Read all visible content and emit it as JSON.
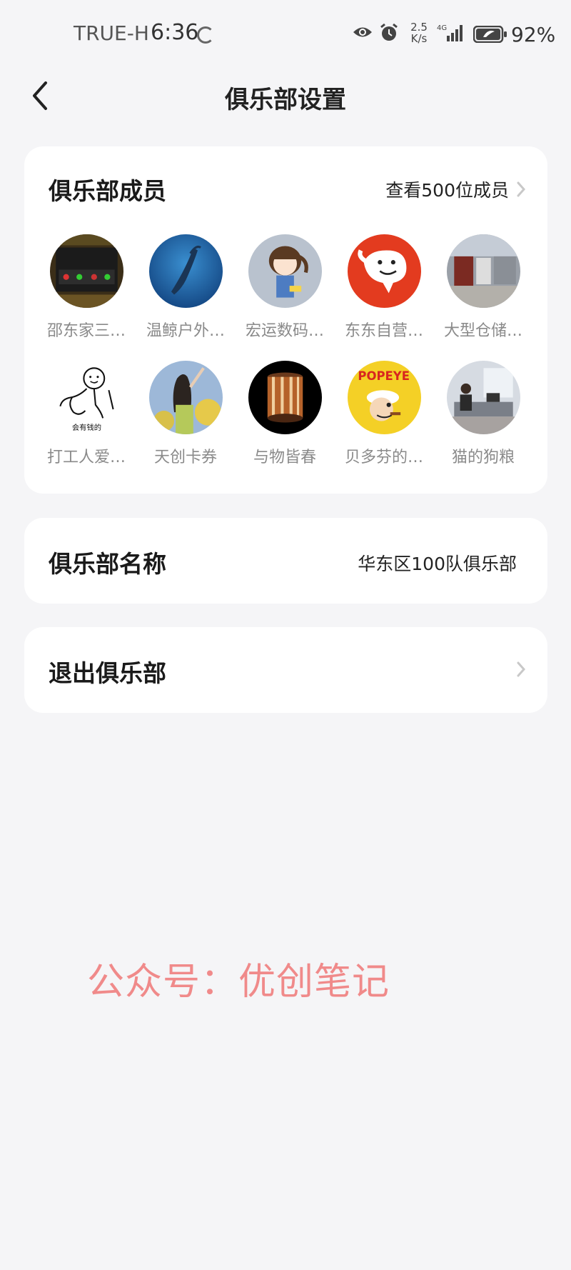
{
  "status_bar": {
    "carrier": "TRUE-H",
    "time": "6:36",
    "net_speed_value": "2.5",
    "net_speed_unit": "K/s",
    "network_type": "4G",
    "battery": "92%"
  },
  "header": {
    "title": "俱乐部设置"
  },
  "members": {
    "title": "俱乐部成员",
    "view_all": "查看500位成员",
    "items": [
      {
        "name": "邵东家三…",
        "avatar": "phone-screenshot-avatar"
      },
      {
        "name": "温鲸户外…",
        "avatar": "whale-avatar"
      },
      {
        "name": "宏运数码…",
        "avatar": "cartoon-girl-avatar"
      },
      {
        "name": "东东自营…",
        "avatar": "jd-dog-avatar"
      },
      {
        "name": "大型仓储…",
        "avatar": "warehouse-avatar"
      },
      {
        "name": "打工人爱…",
        "avatar": "sketch-meme-avatar"
      },
      {
        "name": "天创卡券",
        "avatar": "girl-flowers-avatar"
      },
      {
        "name": "与物皆春",
        "avatar": "lamp-avatar"
      },
      {
        "name": "贝多芬的…",
        "avatar": "popeye-avatar"
      },
      {
        "name": "猫的狗粮",
        "avatar": "office-avatar"
      }
    ],
    "sketch_caption": "会有钱的",
    "popeye_caption": "POPEYE"
  },
  "club_name": {
    "label": "俱乐部名称",
    "value": "华东区100队俱乐部"
  },
  "exit": {
    "label": "退出俱乐部"
  },
  "watermark": "公众号：优创笔记",
  "colors": {
    "background": "#f5f5f7",
    "card": "#ffffff",
    "watermark": "#f08a8a",
    "secondary_text": "#8a8a8a"
  }
}
